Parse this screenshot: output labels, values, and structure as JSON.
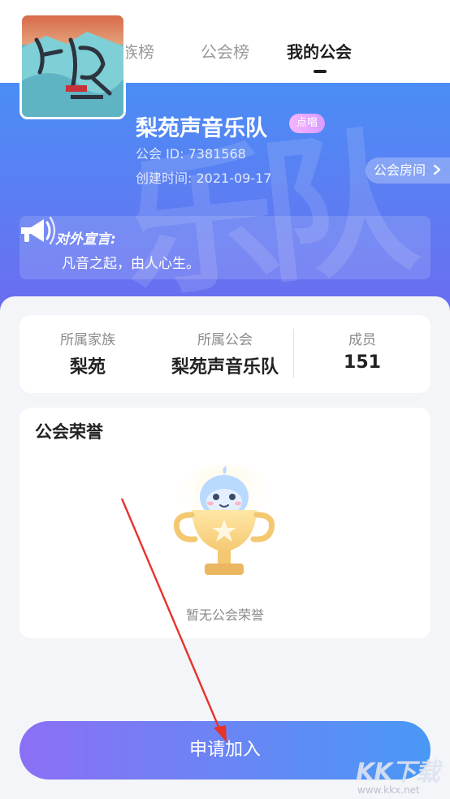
{
  "nav": {
    "tabs": [
      {
        "label": "家族榜",
        "active": false
      },
      {
        "label": "公会榜",
        "active": false
      },
      {
        "label": "我的公会",
        "active": true
      }
    ]
  },
  "guild": {
    "name": "梨苑声音乐队",
    "role_badge": "点唱",
    "id_text": "公会 ID: 7381568",
    "created_text": "创建时间: 2021-09-17",
    "room_button": "公会房间",
    "announcement_title": "对外宣言:",
    "announcement_text": "凡音之起，由人心生。"
  },
  "stats": [
    {
      "label": "所属家族",
      "value": "梨苑"
    },
    {
      "label": "所属公会",
      "value": "梨苑声音乐队"
    },
    {
      "label": "成员",
      "value": "151"
    }
  ],
  "honor": {
    "title": "公会荣誉",
    "empty_text": "暂无公会荣誉"
  },
  "join_button": "申请加入",
  "watermark": {
    "logo": "KK下载",
    "url": "www.kkx.net"
  },
  "colors": {
    "hero_gradient_top": "#4a8df5",
    "hero_gradient_bottom": "#6b6cf0",
    "button_gradient_left": "#8b6ff5",
    "button_gradient_right": "#4a98f6",
    "annotation_arrow": "#e8322a"
  },
  "icons": {
    "back": "arrow-left-icon",
    "room_chevron": "chevron-right-icon",
    "announce": "megaphone-icon",
    "trophy": "trophy-mascot-icon"
  }
}
